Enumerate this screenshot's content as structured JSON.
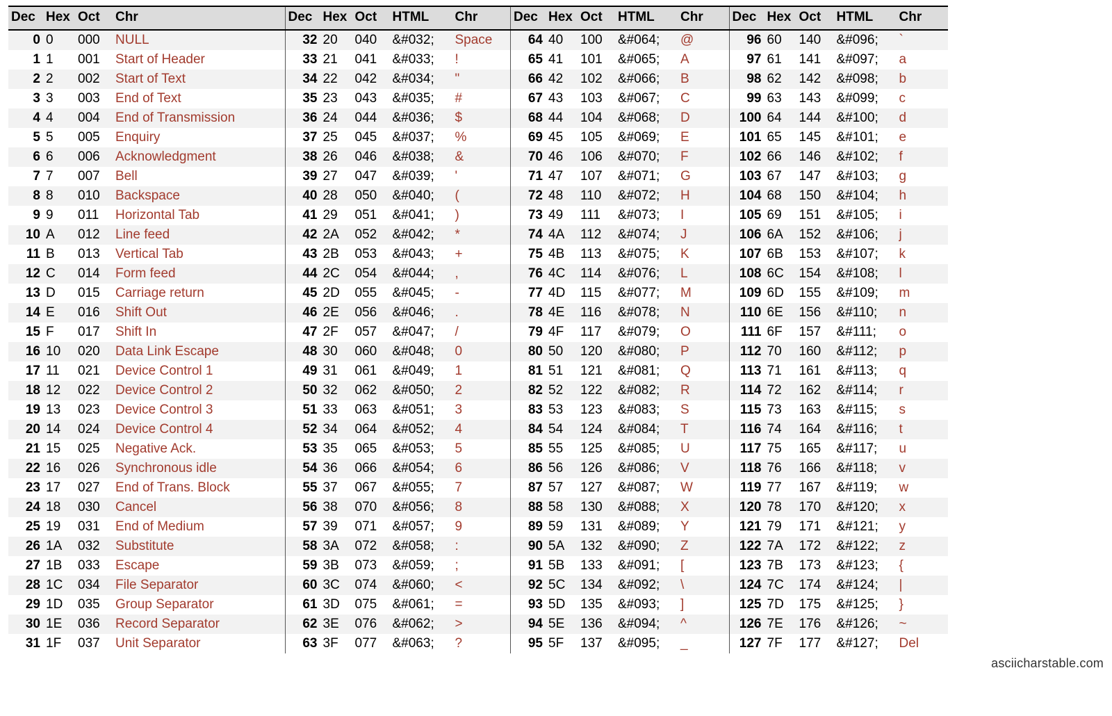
{
  "footer": "asciicharstable.com",
  "headers": {
    "dec": "Dec",
    "hex": "Hex",
    "oct": "Oct",
    "html": "HTML",
    "chr": "Chr"
  },
  "sections": [
    {
      "hasHtml": false,
      "rows": [
        {
          "dec": "0",
          "hex": "0",
          "oct": "000",
          "chr": "NULL"
        },
        {
          "dec": "1",
          "hex": "1",
          "oct": "001",
          "chr": "Start of Header"
        },
        {
          "dec": "2",
          "hex": "2",
          "oct": "002",
          "chr": "Start of Text"
        },
        {
          "dec": "3",
          "hex": "3",
          "oct": "003",
          "chr": "End of Text"
        },
        {
          "dec": "4",
          "hex": "4",
          "oct": "004",
          "chr": "End of Transmission"
        },
        {
          "dec": "5",
          "hex": "5",
          "oct": "005",
          "chr": "Enquiry"
        },
        {
          "dec": "6",
          "hex": "6",
          "oct": "006",
          "chr": "Acknowledgment"
        },
        {
          "dec": "7",
          "hex": "7",
          "oct": "007",
          "chr": "Bell"
        },
        {
          "dec": "8",
          "hex": "8",
          "oct": "010",
          "chr": "Backspace"
        },
        {
          "dec": "9",
          "hex": "9",
          "oct": "011",
          "chr": "Horizontal Tab"
        },
        {
          "dec": "10",
          "hex": "A",
          "oct": "012",
          "chr": "Line feed"
        },
        {
          "dec": "11",
          "hex": "B",
          "oct": "013",
          "chr": "Vertical Tab"
        },
        {
          "dec": "12",
          "hex": "C",
          "oct": "014",
          "chr": "Form feed"
        },
        {
          "dec": "13",
          "hex": "D",
          "oct": "015",
          "chr": "Carriage return"
        },
        {
          "dec": "14",
          "hex": "E",
          "oct": "016",
          "chr": "Shift Out"
        },
        {
          "dec": "15",
          "hex": "F",
          "oct": "017",
          "chr": "Shift In"
        },
        {
          "dec": "16",
          "hex": "10",
          "oct": "020",
          "chr": "Data Link Escape"
        },
        {
          "dec": "17",
          "hex": "11",
          "oct": "021",
          "chr": "Device Control 1"
        },
        {
          "dec": "18",
          "hex": "12",
          "oct": "022",
          "chr": "Device Control 2"
        },
        {
          "dec": "19",
          "hex": "13",
          "oct": "023",
          "chr": "Device Control 3"
        },
        {
          "dec": "20",
          "hex": "14",
          "oct": "024",
          "chr": "Device Control 4"
        },
        {
          "dec": "21",
          "hex": "15",
          "oct": "025",
          "chr": "Negative Ack."
        },
        {
          "dec": "22",
          "hex": "16",
          "oct": "026",
          "chr": "Synchronous idle"
        },
        {
          "dec": "23",
          "hex": "17",
          "oct": "027",
          "chr": "End of Trans. Block"
        },
        {
          "dec": "24",
          "hex": "18",
          "oct": "030",
          "chr": "Cancel"
        },
        {
          "dec": "25",
          "hex": "19",
          "oct": "031",
          "chr": "End of Medium"
        },
        {
          "dec": "26",
          "hex": "1A",
          "oct": "032",
          "chr": "Substitute"
        },
        {
          "dec": "27",
          "hex": "1B",
          "oct": "033",
          "chr": "Escape"
        },
        {
          "dec": "28",
          "hex": "1C",
          "oct": "034",
          "chr": "File Separator"
        },
        {
          "dec": "29",
          "hex": "1D",
          "oct": "035",
          "chr": "Group Separator"
        },
        {
          "dec": "30",
          "hex": "1E",
          "oct": "036",
          "chr": "Record Separator"
        },
        {
          "dec": "31",
          "hex": "1F",
          "oct": "037",
          "chr": "Unit Separator"
        }
      ]
    },
    {
      "hasHtml": true,
      "rows": [
        {
          "dec": "32",
          "hex": "20",
          "oct": "040",
          "html": "&#032;",
          "chr": "Space"
        },
        {
          "dec": "33",
          "hex": "21",
          "oct": "041",
          "html": "&#033;",
          "chr": "!"
        },
        {
          "dec": "34",
          "hex": "22",
          "oct": "042",
          "html": "&#034;",
          "chr": "\""
        },
        {
          "dec": "35",
          "hex": "23",
          "oct": "043",
          "html": "&#035;",
          "chr": "#"
        },
        {
          "dec": "36",
          "hex": "24",
          "oct": "044",
          "html": "&#036;",
          "chr": "$"
        },
        {
          "dec": "37",
          "hex": "25",
          "oct": "045",
          "html": "&#037;",
          "chr": "%"
        },
        {
          "dec": "38",
          "hex": "26",
          "oct": "046",
          "html": "&#038;",
          "chr": "&"
        },
        {
          "dec": "39",
          "hex": "27",
          "oct": "047",
          "html": "&#039;",
          "chr": "'"
        },
        {
          "dec": "40",
          "hex": "28",
          "oct": "050",
          "html": "&#040;",
          "chr": "("
        },
        {
          "dec": "41",
          "hex": "29",
          "oct": "051",
          "html": "&#041;",
          "chr": ")"
        },
        {
          "dec": "42",
          "hex": "2A",
          "oct": "052",
          "html": "&#042;",
          "chr": "*"
        },
        {
          "dec": "43",
          "hex": "2B",
          "oct": "053",
          "html": "&#043;",
          "chr": "+"
        },
        {
          "dec": "44",
          "hex": "2C",
          "oct": "054",
          "html": "&#044;",
          "chr": ","
        },
        {
          "dec": "45",
          "hex": "2D",
          "oct": "055",
          "html": "&#045;",
          "chr": "-"
        },
        {
          "dec": "46",
          "hex": "2E",
          "oct": "056",
          "html": "&#046;",
          "chr": "."
        },
        {
          "dec": "47",
          "hex": "2F",
          "oct": "057",
          "html": "&#047;",
          "chr": "/"
        },
        {
          "dec": "48",
          "hex": "30",
          "oct": "060",
          "html": "&#048;",
          "chr": "0"
        },
        {
          "dec": "49",
          "hex": "31",
          "oct": "061",
          "html": "&#049;",
          "chr": "1"
        },
        {
          "dec": "50",
          "hex": "32",
          "oct": "062",
          "html": "&#050;",
          "chr": "2"
        },
        {
          "dec": "51",
          "hex": "33",
          "oct": "063",
          "html": "&#051;",
          "chr": "3"
        },
        {
          "dec": "52",
          "hex": "34",
          "oct": "064",
          "html": "&#052;",
          "chr": "4"
        },
        {
          "dec": "53",
          "hex": "35",
          "oct": "065",
          "html": "&#053;",
          "chr": "5"
        },
        {
          "dec": "54",
          "hex": "36",
          "oct": "066",
          "html": "&#054;",
          "chr": "6"
        },
        {
          "dec": "55",
          "hex": "37",
          "oct": "067",
          "html": "&#055;",
          "chr": "7"
        },
        {
          "dec": "56",
          "hex": "38",
          "oct": "070",
          "html": "&#056;",
          "chr": "8"
        },
        {
          "dec": "57",
          "hex": "39",
          "oct": "071",
          "html": "&#057;",
          "chr": "9"
        },
        {
          "dec": "58",
          "hex": "3A",
          "oct": "072",
          "html": "&#058;",
          "chr": ":"
        },
        {
          "dec": "59",
          "hex": "3B",
          "oct": "073",
          "html": "&#059;",
          "chr": ";"
        },
        {
          "dec": "60",
          "hex": "3C",
          "oct": "074",
          "html": "&#060;",
          "chr": "<"
        },
        {
          "dec": "61",
          "hex": "3D",
          "oct": "075",
          "html": "&#061;",
          "chr": "="
        },
        {
          "dec": "62",
          "hex": "3E",
          "oct": "076",
          "html": "&#062;",
          "chr": ">"
        },
        {
          "dec": "63",
          "hex": "3F",
          "oct": "077",
          "html": "&#063;",
          "chr": "?"
        }
      ]
    },
    {
      "hasHtml": true,
      "rows": [
        {
          "dec": "64",
          "hex": "40",
          "oct": "100",
          "html": "&#064;",
          "chr": "@"
        },
        {
          "dec": "65",
          "hex": "41",
          "oct": "101",
          "html": "&#065;",
          "chr": "A"
        },
        {
          "dec": "66",
          "hex": "42",
          "oct": "102",
          "html": "&#066;",
          "chr": "B"
        },
        {
          "dec": "67",
          "hex": "43",
          "oct": "103",
          "html": "&#067;",
          "chr": "C"
        },
        {
          "dec": "68",
          "hex": "44",
          "oct": "104",
          "html": "&#068;",
          "chr": "D"
        },
        {
          "dec": "69",
          "hex": "45",
          "oct": "105",
          "html": "&#069;",
          "chr": "E"
        },
        {
          "dec": "70",
          "hex": "46",
          "oct": "106",
          "html": "&#070;",
          "chr": "F"
        },
        {
          "dec": "71",
          "hex": "47",
          "oct": "107",
          "html": "&#071;",
          "chr": "G"
        },
        {
          "dec": "72",
          "hex": "48",
          "oct": "110",
          "html": "&#072;",
          "chr": "H"
        },
        {
          "dec": "73",
          "hex": "49",
          "oct": "111",
          "html": "&#073;",
          "chr": "I"
        },
        {
          "dec": "74",
          "hex": "4A",
          "oct": "112",
          "html": "&#074;",
          "chr": "J"
        },
        {
          "dec": "75",
          "hex": "4B",
          "oct": "113",
          "html": "&#075;",
          "chr": "K"
        },
        {
          "dec": "76",
          "hex": "4C",
          "oct": "114",
          "html": "&#076;",
          "chr": "L"
        },
        {
          "dec": "77",
          "hex": "4D",
          "oct": "115",
          "html": "&#077;",
          "chr": "M"
        },
        {
          "dec": "78",
          "hex": "4E",
          "oct": "116",
          "html": "&#078;",
          "chr": "N"
        },
        {
          "dec": "79",
          "hex": "4F",
          "oct": "117",
          "html": "&#079;",
          "chr": "O"
        },
        {
          "dec": "80",
          "hex": "50",
          "oct": "120",
          "html": "&#080;",
          "chr": "P"
        },
        {
          "dec": "81",
          "hex": "51",
          "oct": "121",
          "html": "&#081;",
          "chr": "Q"
        },
        {
          "dec": "82",
          "hex": "52",
          "oct": "122",
          "html": "&#082;",
          "chr": "R"
        },
        {
          "dec": "83",
          "hex": "53",
          "oct": "123",
          "html": "&#083;",
          "chr": "S"
        },
        {
          "dec": "84",
          "hex": "54",
          "oct": "124",
          "html": "&#084;",
          "chr": "T"
        },
        {
          "dec": "85",
          "hex": "55",
          "oct": "125",
          "html": "&#085;",
          "chr": "U"
        },
        {
          "dec": "86",
          "hex": "56",
          "oct": "126",
          "html": "&#086;",
          "chr": "V"
        },
        {
          "dec": "87",
          "hex": "57",
          "oct": "127",
          "html": "&#087;",
          "chr": "W"
        },
        {
          "dec": "88",
          "hex": "58",
          "oct": "130",
          "html": "&#088;",
          "chr": "X"
        },
        {
          "dec": "89",
          "hex": "59",
          "oct": "131",
          "html": "&#089;",
          "chr": "Y"
        },
        {
          "dec": "90",
          "hex": "5A",
          "oct": "132",
          "html": "&#090;",
          "chr": "Z"
        },
        {
          "dec": "91",
          "hex": "5B",
          "oct": "133",
          "html": "&#091;",
          "chr": "["
        },
        {
          "dec": "92",
          "hex": "5C",
          "oct": "134",
          "html": "&#092;",
          "chr": "\\"
        },
        {
          "dec": "93",
          "hex": "5D",
          "oct": "135",
          "html": "&#093;",
          "chr": "]"
        },
        {
          "dec": "94",
          "hex": "5E",
          "oct": "136",
          "html": "&#094;",
          "chr": "^"
        },
        {
          "dec": "95",
          "hex": "5F",
          "oct": "137",
          "html": "&#095;",
          "chr": "_"
        }
      ]
    },
    {
      "hasHtml": true,
      "rows": [
        {
          "dec": "96",
          "hex": "60",
          "oct": "140",
          "html": "&#096;",
          "chr": "`"
        },
        {
          "dec": "97",
          "hex": "61",
          "oct": "141",
          "html": "&#097;",
          "chr": "a"
        },
        {
          "dec": "98",
          "hex": "62",
          "oct": "142",
          "html": "&#098;",
          "chr": "b"
        },
        {
          "dec": "99",
          "hex": "63",
          "oct": "143",
          "html": "&#099;",
          "chr": "c"
        },
        {
          "dec": "100",
          "hex": "64",
          "oct": "144",
          "html": "&#100;",
          "chr": "d"
        },
        {
          "dec": "101",
          "hex": "65",
          "oct": "145",
          "html": "&#101;",
          "chr": "e"
        },
        {
          "dec": "102",
          "hex": "66",
          "oct": "146",
          "html": "&#102;",
          "chr": "f"
        },
        {
          "dec": "103",
          "hex": "67",
          "oct": "147",
          "html": "&#103;",
          "chr": "g"
        },
        {
          "dec": "104",
          "hex": "68",
          "oct": "150",
          "html": "&#104;",
          "chr": "h"
        },
        {
          "dec": "105",
          "hex": "69",
          "oct": "151",
          "html": "&#105;",
          "chr": "i"
        },
        {
          "dec": "106",
          "hex": "6A",
          "oct": "152",
          "html": "&#106;",
          "chr": "j"
        },
        {
          "dec": "107",
          "hex": "6B",
          "oct": "153",
          "html": "&#107;",
          "chr": "k"
        },
        {
          "dec": "108",
          "hex": "6C",
          "oct": "154",
          "html": "&#108;",
          "chr": "l"
        },
        {
          "dec": "109",
          "hex": "6D",
          "oct": "155",
          "html": "&#109;",
          "chr": "m"
        },
        {
          "dec": "110",
          "hex": "6E",
          "oct": "156",
          "html": "&#110;",
          "chr": "n"
        },
        {
          "dec": "111",
          "hex": "6F",
          "oct": "157",
          "html": "&#111;",
          "chr": "o"
        },
        {
          "dec": "112",
          "hex": "70",
          "oct": "160",
          "html": "&#112;",
          "chr": "p"
        },
        {
          "dec": "113",
          "hex": "71",
          "oct": "161",
          "html": "&#113;",
          "chr": "q"
        },
        {
          "dec": "114",
          "hex": "72",
          "oct": "162",
          "html": "&#114;",
          "chr": "r"
        },
        {
          "dec": "115",
          "hex": "73",
          "oct": "163",
          "html": "&#115;",
          "chr": "s"
        },
        {
          "dec": "116",
          "hex": "74",
          "oct": "164",
          "html": "&#116;",
          "chr": "t"
        },
        {
          "dec": "117",
          "hex": "75",
          "oct": "165",
          "html": "&#117;",
          "chr": "u"
        },
        {
          "dec": "118",
          "hex": "76",
          "oct": "166",
          "html": "&#118;",
          "chr": "v"
        },
        {
          "dec": "119",
          "hex": "77",
          "oct": "167",
          "html": "&#119;",
          "chr": "w"
        },
        {
          "dec": "120",
          "hex": "78",
          "oct": "170",
          "html": "&#120;",
          "chr": "x"
        },
        {
          "dec": "121",
          "hex": "79",
          "oct": "171",
          "html": "&#121;",
          "chr": "y"
        },
        {
          "dec": "122",
          "hex": "7A",
          "oct": "172",
          "html": "&#122;",
          "chr": "z"
        },
        {
          "dec": "123",
          "hex": "7B",
          "oct": "173",
          "html": "&#123;",
          "chr": "{"
        },
        {
          "dec": "124",
          "hex": "7C",
          "oct": "174",
          "html": "&#124;",
          "chr": "|"
        },
        {
          "dec": "125",
          "hex": "7D",
          "oct": "175",
          "html": "&#125;",
          "chr": "}"
        },
        {
          "dec": "126",
          "hex": "7E",
          "oct": "176",
          "html": "&#126;",
          "chr": "~"
        },
        {
          "dec": "127",
          "hex": "7F",
          "oct": "177",
          "html": "&#127;",
          "chr": "Del"
        }
      ]
    }
  ]
}
